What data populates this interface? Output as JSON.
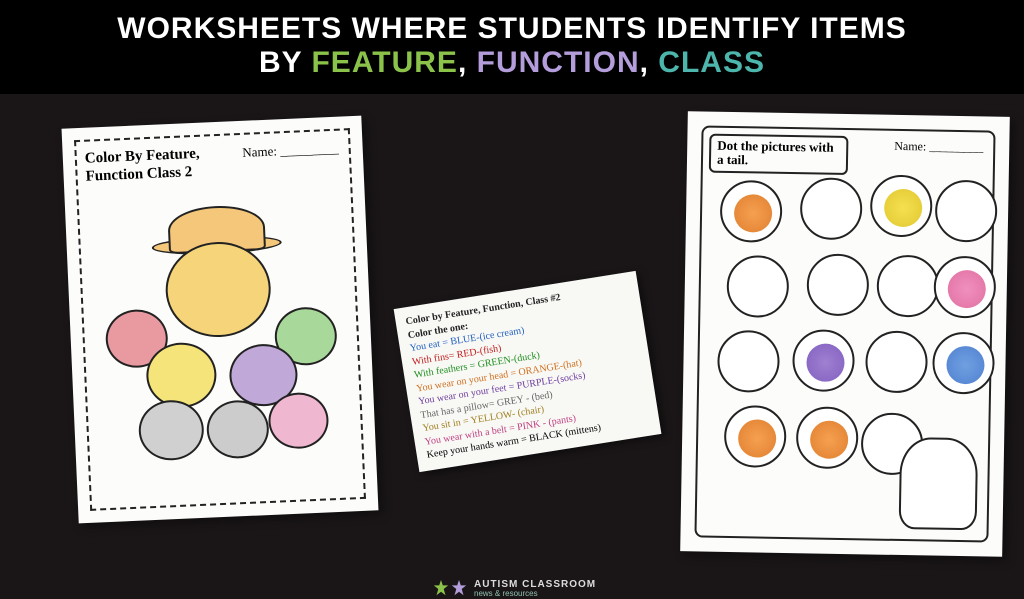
{
  "header": {
    "line1": "WORKSHEETS WHERE STUDENTS IDENTIFY ITEMS",
    "by": "BY",
    "feature": "FEATURE",
    "function": "FUNCTION",
    "class": "CLASS"
  },
  "worksheet1": {
    "title": "Color By Feature, Function Class 2",
    "name_label": "Name:"
  },
  "card": {
    "title": "Color by Feature, Function, Class #2",
    "sub": "Color the one:",
    "rules": [
      {
        "text": "You eat = BLUE-(ice cream)",
        "cls": "r-blue"
      },
      {
        "text": "With fins= RED-(fish)",
        "cls": "r-red"
      },
      {
        "text": "With feathers = GREEN-(duck)",
        "cls": "r-green"
      },
      {
        "text": "You wear on your head = ORANGE-(hat)",
        "cls": "r-orange"
      },
      {
        "text": "You wear on your feet = PURPLE-(socks)",
        "cls": "r-purple"
      },
      {
        "text": "That has a pillow= GREY - (bed)",
        "cls": "r-grey"
      },
      {
        "text": "You sit in = YELLOW- (chair)",
        "cls": "r-gold"
      },
      {
        "text": "You wear with a belt = PINK - (pants)",
        "cls": "r-pink"
      },
      {
        "text": "Keep your hands warm = BLACK (mittens)",
        "cls": "r-black"
      }
    ]
  },
  "worksheet2": {
    "title": "Dot the pictures with a tail.",
    "name_label": "Name:"
  },
  "logo": {
    "t1": "AUTISM CLASSROOM",
    "t2": "news & resources"
  }
}
